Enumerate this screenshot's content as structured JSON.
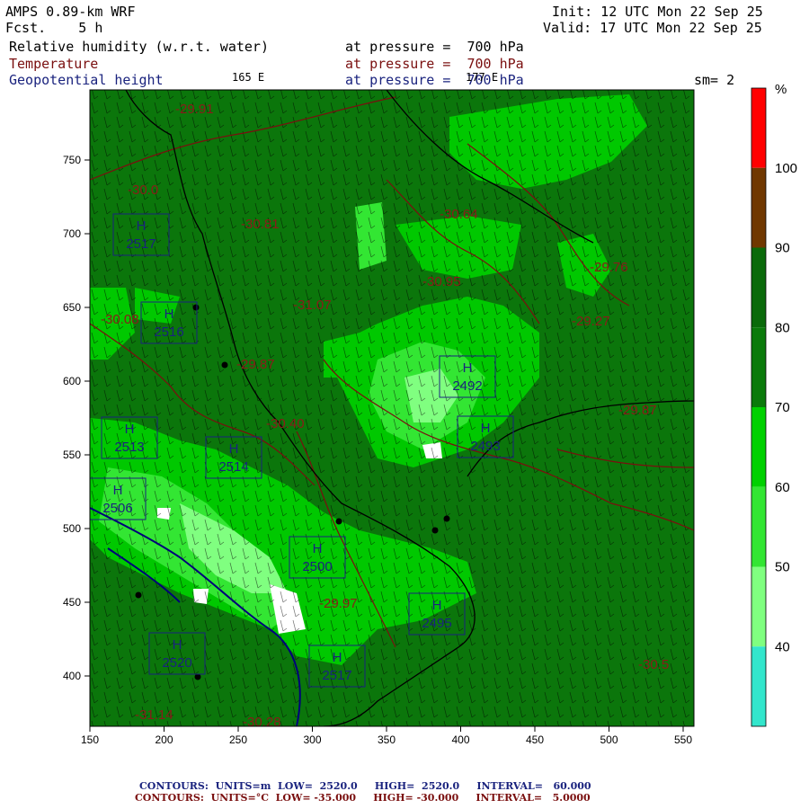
{
  "header": {
    "model": "AMPS 0.89-km WRF",
    "fcst_label": "Fcst.",
    "fcst_value": "5 h",
    "init": "Init: 12 UTC Mon 22 Sep 25",
    "valid": "Valid: 17 UTC Mon 22 Sep 25",
    "field1": "Relative humidity (w.r.t. water)",
    "field1_level": "at pressure =  700 hPa",
    "field2": "Temperature",
    "field2_level": "at pressure =  700 hPa",
    "field3": "Geopotential height",
    "field3_level": "at pressure =  700 hPa",
    "lon_left": "165 E",
    "lon_right": "177 E",
    "smoothing": "sm= 2"
  },
  "colorbar": {
    "unit": "%",
    "levels": [
      "40",
      "50",
      "60",
      "70",
      "80",
      "90",
      "100"
    ],
    "colors": [
      "#33e6cc",
      "#80ff80",
      "#33e633",
      "#00d100",
      "#0a7a0a",
      "#0a6a0a",
      "#703800",
      "#ff0000"
    ]
  },
  "axes": {
    "x_ticks": [
      "150",
      "200",
      "250",
      "300",
      "350",
      "400",
      "450",
      "500",
      "550"
    ],
    "y_ticks": [
      "750",
      "700",
      "650",
      "600",
      "550",
      "500",
      "450",
      "400"
    ]
  },
  "highs": [
    {
      "label": "H",
      "value": "2517"
    },
    {
      "label": "H",
      "value": "2516"
    },
    {
      "label": "H",
      "value": "2513"
    },
    {
      "label": "H",
      "value": "2514"
    },
    {
      "label": "H",
      "value": "2506"
    },
    {
      "label": "H",
      "value": "2492"
    },
    {
      "label": "H",
      "value": "2493"
    },
    {
      "label": "H",
      "value": "2500"
    },
    {
      "label": "H",
      "value": "2520"
    },
    {
      "label": "H",
      "value": "2495"
    },
    {
      "label": "H",
      "value": "2517"
    }
  ],
  "temps": [
    "-29.91",
    "-30.0",
    "-30.81",
    "-30.08",
    "-31.07",
    "-29.87",
    "-30.40",
    "-30.95",
    "-29.76",
    "-29.27",
    "-30.64",
    "-29.87",
    "-30.5",
    "-29.97",
    "-30.28",
    "-31.14"
  ],
  "footer": {
    "line1": {
      "label": "CONTOURS:",
      "units": "UNITS=m",
      "low": "LOW=  2520.0",
      "high": "HIGH=  2520.0",
      "interval": "INTERVAL=   60.000"
    },
    "line2": {
      "label": "CONTOURS:",
      "units": "UNITS=°C",
      "low": "LOW= -35.000",
      "high": "HIGH= -30.000",
      "interval": "INTERVAL=   5.0000"
    }
  }
}
